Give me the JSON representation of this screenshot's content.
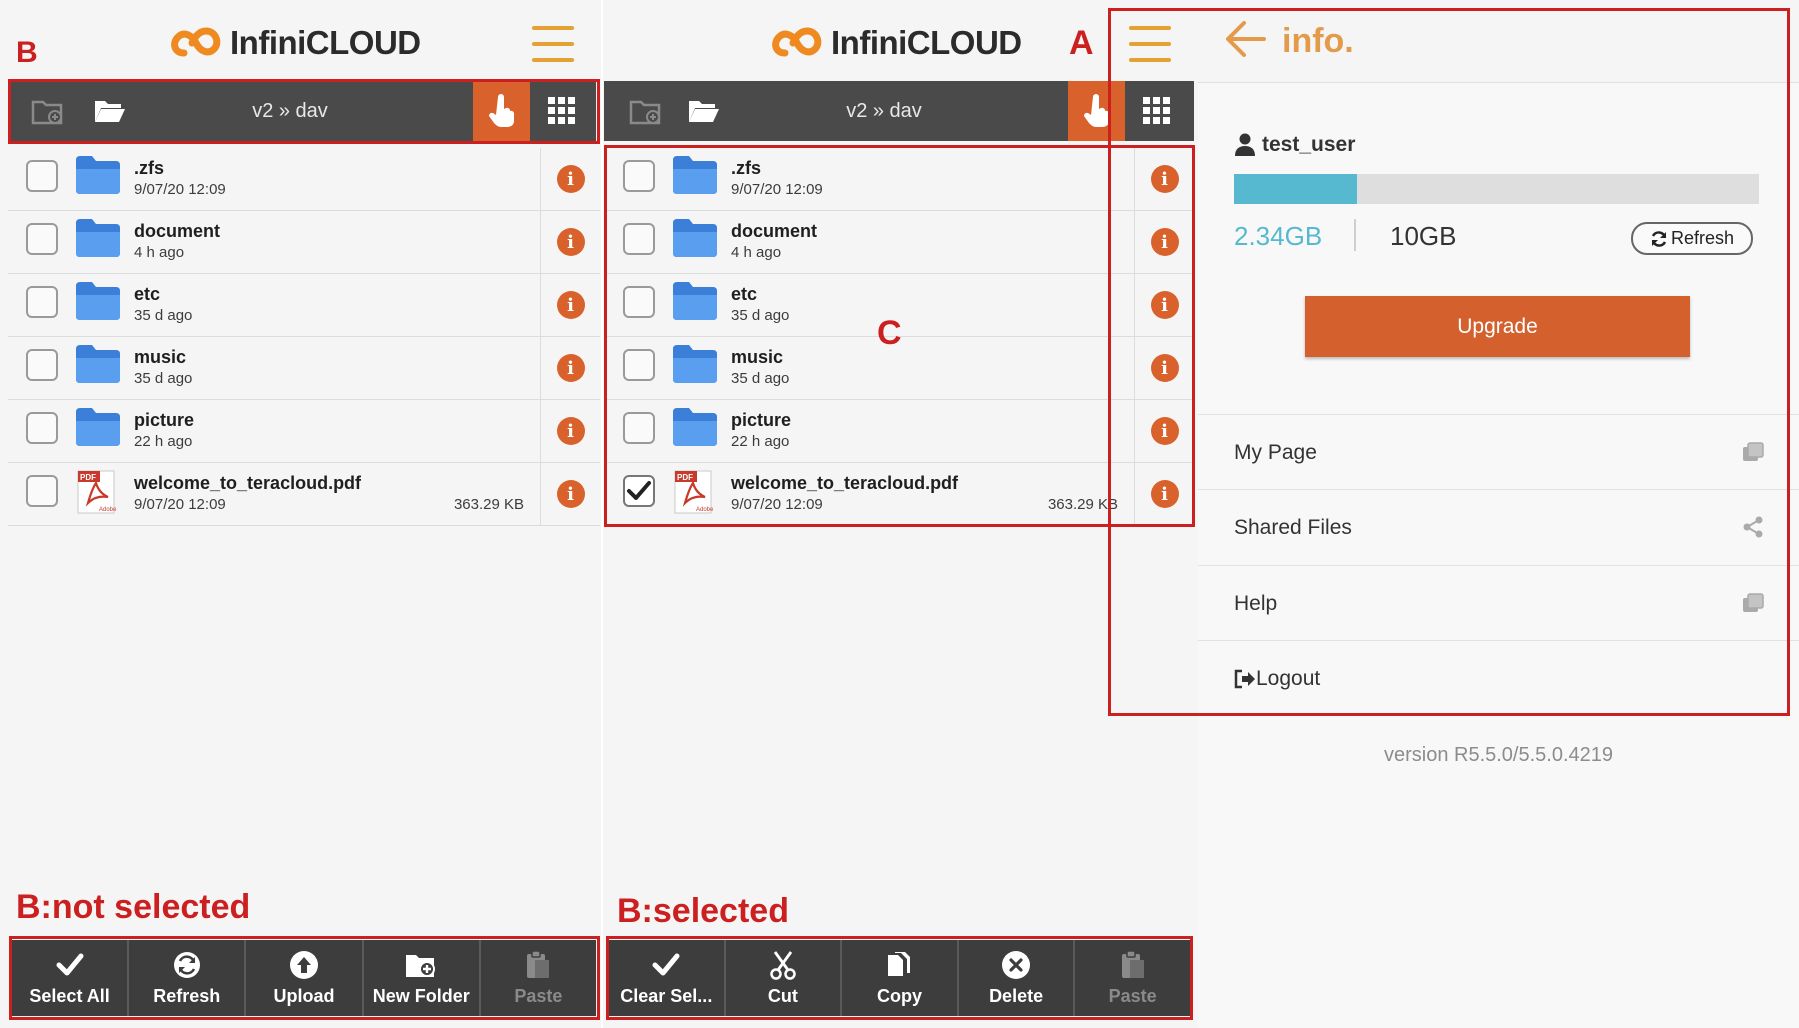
{
  "brand": {
    "logo_text": "InfiniCLOUD",
    "accent": "#d9622c",
    "menu_color": "#e3a233"
  },
  "toolbar": {
    "breadcrumb": "v2 » dav"
  },
  "files": [
    {
      "name": ".zfs",
      "meta": "9/07/20 12:09",
      "size": "",
      "type": "folder"
    },
    {
      "name": "document",
      "meta": "4 h ago",
      "size": "",
      "type": "folder"
    },
    {
      "name": "etc",
      "meta": "35 d ago",
      "size": "",
      "type": "folder"
    },
    {
      "name": "music",
      "meta": "35 d ago",
      "size": "",
      "type": "folder"
    },
    {
      "name": "picture",
      "meta": "22 h ago",
      "size": "",
      "type": "folder"
    },
    {
      "name": "welcome_to_teracloud.pdf",
      "meta": "9/07/20 12:09",
      "size": "363.29 KB",
      "type": "pdf"
    }
  ],
  "pdf_icon": {
    "top_text": "PDF",
    "bottom_text": "Adobe"
  },
  "panel_left": {
    "annotation_top": "B",
    "annotation_bottom": "B:not selected",
    "bottom_actions": [
      "Select All",
      "Refresh",
      "Upload",
      "New Folder",
      "Paste"
    ]
  },
  "panel_middle": {
    "annotation_a": "A",
    "annotation_c": "C",
    "annotation_bottom": "B:selected",
    "checked_index": 5,
    "bottom_actions": [
      "Clear Sel...",
      "Cut",
      "Copy",
      "Delete",
      "Paste"
    ]
  },
  "info": {
    "title": "info.",
    "username": "test_user",
    "used": "2.34GB",
    "total": "10GB",
    "used_fraction": 0.234,
    "refresh_label": "Refresh",
    "upgrade_label": "Upgrade",
    "menu": [
      "My Page",
      "Shared Files",
      "Help",
      "Logout"
    ],
    "version": "version R5.5.0/5.5.0.4219"
  }
}
